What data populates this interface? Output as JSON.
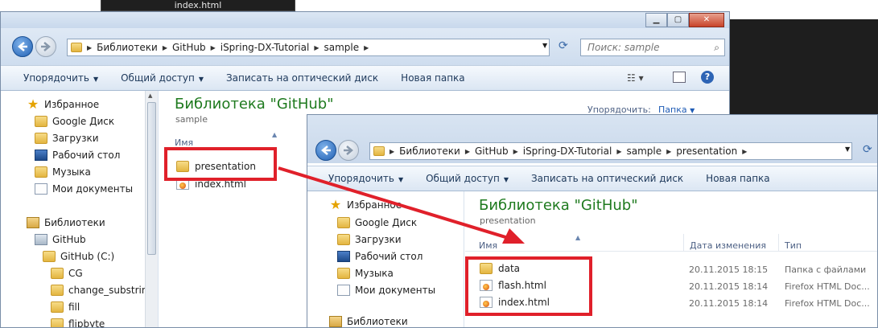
{
  "background_tab": {
    "title": "index.html"
  },
  "back_window": {
    "breadcrumb": [
      "Библиотеки",
      "GitHub",
      "iSpring-DX-Tutorial",
      "sample"
    ],
    "search_placeholder": "Поиск: sample",
    "toolbar": [
      "Упорядочить",
      "Общий доступ",
      "Записать на оптический диск",
      "Новая папка"
    ],
    "nav": [
      {
        "label": "Избранное",
        "icon": "star-icon"
      },
      {
        "label": "Google Диск",
        "icon": "folder-icon"
      },
      {
        "label": "Загрузки",
        "icon": "folder-icon"
      },
      {
        "label": "Рабочий стол",
        "icon": "desktop-icon"
      },
      {
        "label": "Музыка",
        "icon": "folder-icon"
      },
      {
        "label": "Мои документы",
        "icon": "document-icon"
      },
      {
        "label": "Библиотеки",
        "icon": "library-icon"
      },
      {
        "label": "GitHub",
        "icon": "library-icon"
      },
      {
        "label": "GitHub (C:)",
        "icon": "folder-icon"
      },
      {
        "label": "CG",
        "icon": "folder-icon"
      },
      {
        "label": "change_substring",
        "icon": "folder-icon"
      },
      {
        "label": "fill",
        "icon": "folder-icon"
      },
      {
        "label": "flipbyte",
        "icon": "folder-icon"
      }
    ],
    "library_title": "Библиотека \"GitHub\"",
    "library_sub": "sample",
    "arrange_label": "Упорядочить:",
    "arrange_value": "Папка",
    "column_name": "Имя",
    "files": [
      {
        "name": "presentation",
        "icon": "folder-icon"
      },
      {
        "name": "index.html",
        "icon": "html-file-icon"
      }
    ]
  },
  "front_window": {
    "breadcrumb": [
      "Библиотеки",
      "GitHub",
      "iSpring-DX-Tutorial",
      "sample",
      "presentation"
    ],
    "toolbar": [
      "Упорядочить",
      "Общий доступ",
      "Записать на оптический диск",
      "Новая папка"
    ],
    "nav": [
      {
        "label": "Избранное",
        "icon": "star-icon"
      },
      {
        "label": "Google Диск",
        "icon": "folder-icon"
      },
      {
        "label": "Загрузки",
        "icon": "folder-icon"
      },
      {
        "label": "Рабочий стол",
        "icon": "desktop-icon"
      },
      {
        "label": "Музыка",
        "icon": "folder-icon"
      },
      {
        "label": "Мои документы",
        "icon": "document-icon"
      },
      {
        "label": "Библиотеки",
        "icon": "library-icon"
      }
    ],
    "library_title": "Библиотека \"GitHub\"",
    "library_sub": "presentation",
    "columns": [
      "Имя",
      "Дата изменения",
      "Тип"
    ],
    "files": [
      {
        "name": "data",
        "date": "20.11.2015 18:15",
        "type": "Папка с файлами",
        "icon": "folder-icon"
      },
      {
        "name": "flash.html",
        "date": "20.11.2015 18:14",
        "type": "Firefox HTML Doc...",
        "icon": "html-file-icon"
      },
      {
        "name": "index.html",
        "date": "20.11.2015 18:14",
        "type": "Firefox HTML Doc...",
        "icon": "html-file-icon"
      }
    ]
  },
  "colors": {
    "highlight": "#e0202a",
    "library_title": "#1e7a1e"
  }
}
